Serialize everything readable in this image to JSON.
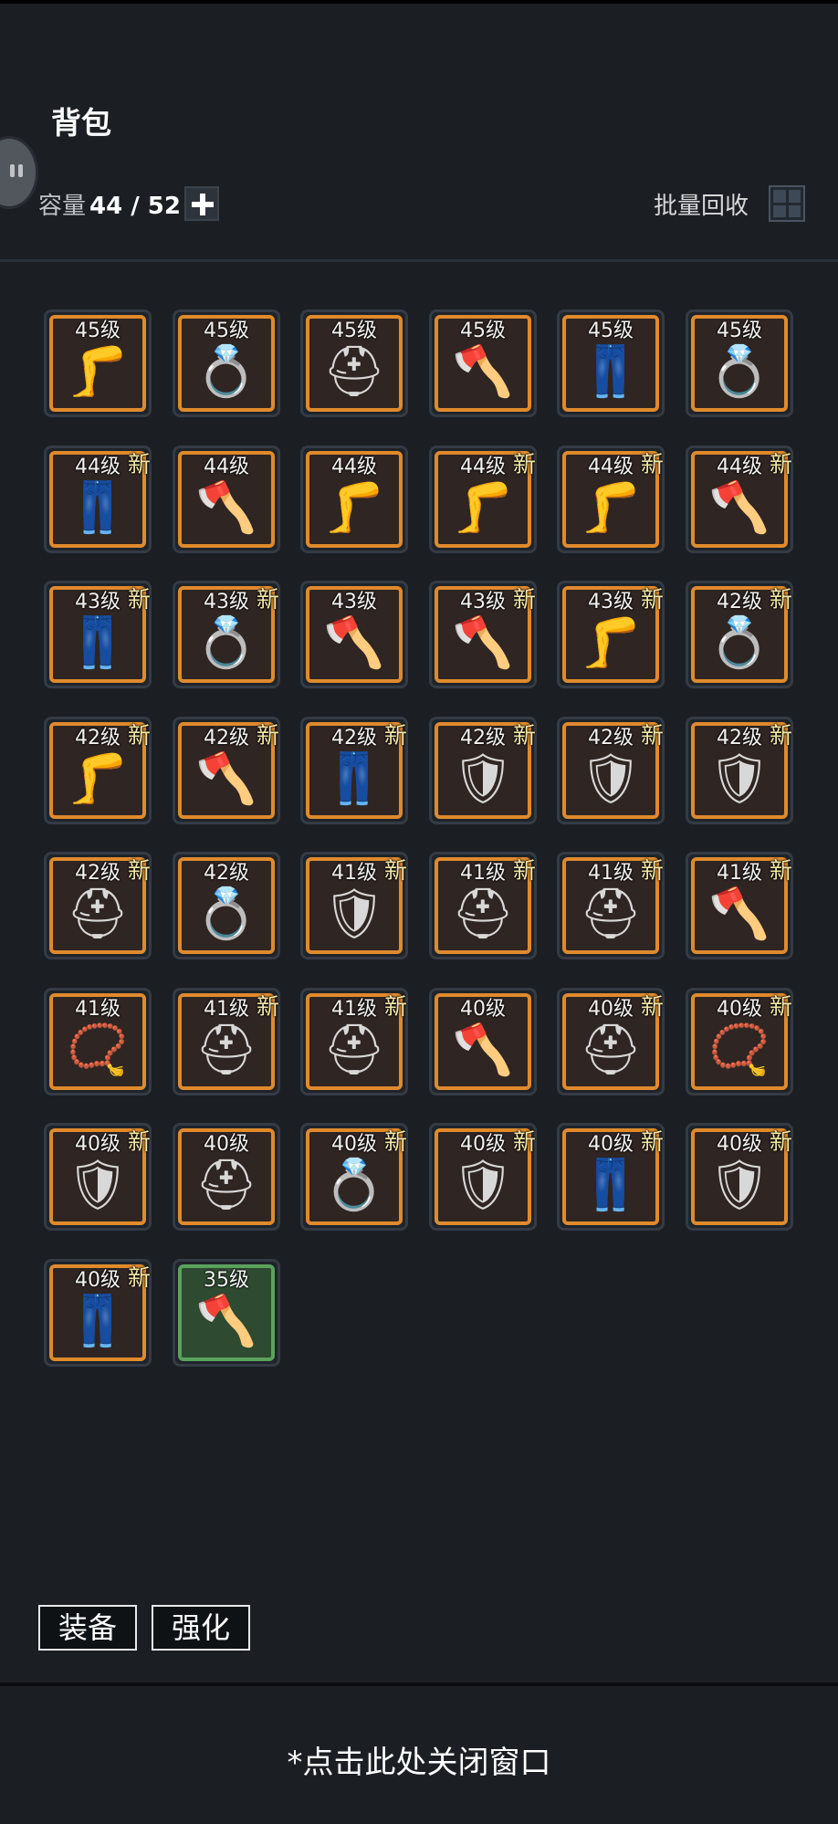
{
  "header": {
    "title": "背包",
    "capacity_label": "容量",
    "capacity_value": "44 / 52",
    "recycle_label": "批量回收"
  },
  "icons": {
    "boot": "🦵",
    "ring": "💍",
    "helmet": "⛑",
    "axe": "🪓",
    "pants": "👖",
    "armor": "🛡",
    "necklace": "📿"
  },
  "items": [
    {
      "level": "45级",
      "type": "boot",
      "new": "",
      "rarity": "orange"
    },
    {
      "level": "45级",
      "type": "ring",
      "new": "",
      "rarity": "orange"
    },
    {
      "level": "45级",
      "type": "helmet",
      "new": "",
      "rarity": "orange"
    },
    {
      "level": "45级",
      "type": "axe",
      "new": "",
      "rarity": "orange"
    },
    {
      "level": "45级",
      "type": "pants",
      "new": "",
      "rarity": "orange"
    },
    {
      "level": "45级",
      "type": "ring",
      "new": "",
      "rarity": "orange"
    },
    {
      "level": "44级",
      "type": "pants",
      "new": "新",
      "rarity": "orange"
    },
    {
      "level": "44级",
      "type": "axe",
      "new": "",
      "rarity": "orange"
    },
    {
      "level": "44级",
      "type": "boot",
      "new": "",
      "rarity": "orange"
    },
    {
      "level": "44级",
      "type": "boot",
      "new": "新",
      "rarity": "orange"
    },
    {
      "level": "44级",
      "type": "boot",
      "new": "新",
      "rarity": "orange"
    },
    {
      "level": "44级",
      "type": "axe",
      "new": "新",
      "rarity": "orange"
    },
    {
      "level": "43级",
      "type": "pants",
      "new": "新",
      "rarity": "orange"
    },
    {
      "level": "43级",
      "type": "ring",
      "new": "新",
      "rarity": "orange"
    },
    {
      "level": "43级",
      "type": "axe",
      "new": "",
      "rarity": "orange"
    },
    {
      "level": "43级",
      "type": "axe",
      "new": "新",
      "rarity": "orange"
    },
    {
      "level": "43级",
      "type": "boot",
      "new": "新",
      "rarity": "orange"
    },
    {
      "level": "42级",
      "type": "ring",
      "new": "新",
      "rarity": "orange"
    },
    {
      "level": "42级",
      "type": "boot",
      "new": "新",
      "rarity": "orange"
    },
    {
      "level": "42级",
      "type": "axe",
      "new": "新",
      "rarity": "orange"
    },
    {
      "level": "42级",
      "type": "pants",
      "new": "新",
      "rarity": "orange"
    },
    {
      "level": "42级",
      "type": "armor",
      "new": "新",
      "rarity": "orange"
    },
    {
      "level": "42级",
      "type": "armor",
      "new": "新",
      "rarity": "orange"
    },
    {
      "level": "42级",
      "type": "armor",
      "new": "新",
      "rarity": "orange"
    },
    {
      "level": "42级",
      "type": "helmet",
      "new": "新",
      "rarity": "orange"
    },
    {
      "level": "42级",
      "type": "ring",
      "new": "",
      "rarity": "orange"
    },
    {
      "level": "41级",
      "type": "armor",
      "new": "新",
      "rarity": "orange"
    },
    {
      "level": "41级",
      "type": "helmet",
      "new": "新",
      "rarity": "orange"
    },
    {
      "level": "41级",
      "type": "helmet",
      "new": "新",
      "rarity": "orange"
    },
    {
      "level": "41级",
      "type": "axe",
      "new": "新",
      "rarity": "orange"
    },
    {
      "level": "41级",
      "type": "necklace",
      "new": "",
      "rarity": "orange"
    },
    {
      "level": "41级",
      "type": "helmet",
      "new": "新",
      "rarity": "orange"
    },
    {
      "level": "41级",
      "type": "helmet",
      "new": "新",
      "rarity": "orange"
    },
    {
      "level": "40级",
      "type": "axe",
      "new": "",
      "rarity": "orange"
    },
    {
      "level": "40级",
      "type": "helmet",
      "new": "新",
      "rarity": "orange"
    },
    {
      "level": "40级",
      "type": "necklace",
      "new": "新",
      "rarity": "orange"
    },
    {
      "level": "40级",
      "type": "armor",
      "new": "新",
      "rarity": "orange"
    },
    {
      "level": "40级",
      "type": "helmet",
      "new": "",
      "rarity": "orange"
    },
    {
      "level": "40级",
      "type": "ring",
      "new": "新",
      "rarity": "orange"
    },
    {
      "level": "40级",
      "type": "armor",
      "new": "新",
      "rarity": "orange"
    },
    {
      "level": "40级",
      "type": "pants",
      "new": "新",
      "rarity": "orange"
    },
    {
      "level": "40级",
      "type": "armor",
      "new": "新",
      "rarity": "orange"
    },
    {
      "level": "40级",
      "type": "pants",
      "new": "新",
      "rarity": "orange"
    },
    {
      "level": "35级",
      "type": "axe",
      "new": "",
      "rarity": "green"
    }
  ],
  "tabs": {
    "equip_label": "装备",
    "enhance_label": "强化"
  },
  "footer": {
    "close_text": "*点击此处关闭窗口"
  },
  "colors": {
    "orange_border": "#e08a2c",
    "green_border": "#5aa25c",
    "new_tag": "#f3e7a6"
  }
}
